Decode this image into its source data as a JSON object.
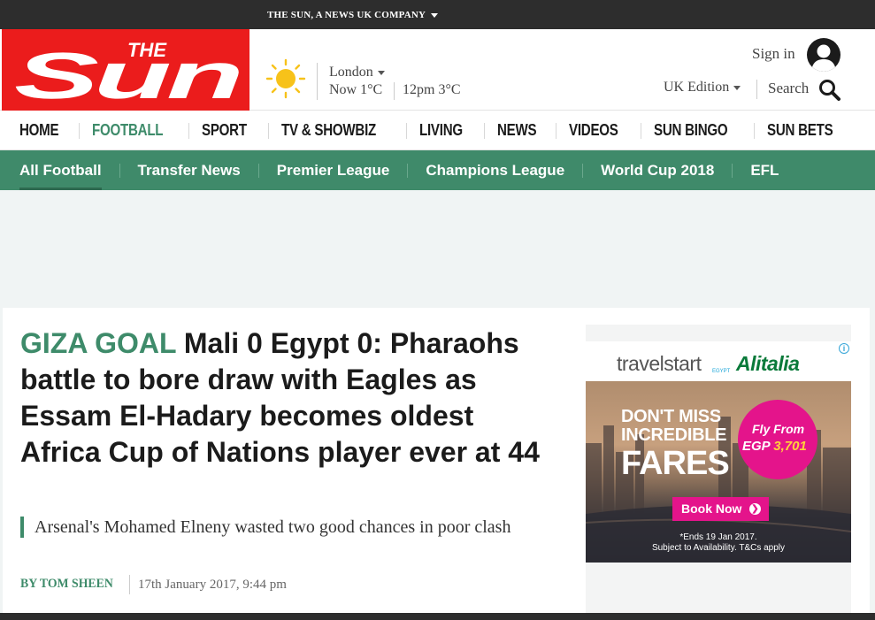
{
  "topbar": {
    "company": "THE SUN, A NEWS UK COMPANY"
  },
  "logo": {
    "line1": "THE",
    "line2": "Sun"
  },
  "weather": {
    "city": "London",
    "now": "Now 1°C",
    "later": "12pm 3°C",
    "icon": "sun-icon"
  },
  "account": {
    "signin": "Sign in",
    "edition": "UK Edition",
    "search": "Search"
  },
  "mainnav": {
    "items": [
      {
        "label": "HOME"
      },
      {
        "label": "FOOTBALL"
      },
      {
        "label": "SPORT"
      },
      {
        "label": "TV & SHOWBIZ"
      },
      {
        "label": "LIVING"
      },
      {
        "label": "NEWS"
      },
      {
        "label": "VIDEOS"
      },
      {
        "label": "SUN BINGO"
      },
      {
        "label": "SUN BETS"
      }
    ],
    "active_index": 1
  },
  "subnav": {
    "items": [
      {
        "label": "All Football"
      },
      {
        "label": "Transfer News"
      },
      {
        "label": "Premier League"
      },
      {
        "label": "Champions League"
      },
      {
        "label": "World Cup 2018"
      },
      {
        "label": "EFL"
      }
    ]
  },
  "article": {
    "kicker": "GIZA GOAL",
    "headline": "Mali 0 Egypt 0: Pharaohs battle to bore draw with Eagles as Essam El-Hadary becomes oldest Africa Cup of Nations player ever at 44",
    "standfirst": "Arsenal's Mohamed Elneny wasted two good chances in poor clash",
    "byline": "BY TOM SHEEN",
    "date": "17th January 2017, 9:44 pm"
  },
  "ad": {
    "brand1": "travelstart",
    "brand1_sub": "EGYPT",
    "brand2": "Alitalia",
    "info": "i",
    "headline1": "DON'T MISS",
    "headline2": "INCREDIBLE",
    "headline3": "FARES",
    "fly": "Fly From",
    "currency": "EGP",
    "amount": "3,701",
    "button": "Book Now",
    "fine1": "*Ends 19 Jan 2017.",
    "fine2": "Subject to Availability. T&Cs apply"
  },
  "colors": {
    "brand_red": "#eb1c1c",
    "accent_green": "#3e8b6a",
    "ad_pink": "#e4148b"
  }
}
